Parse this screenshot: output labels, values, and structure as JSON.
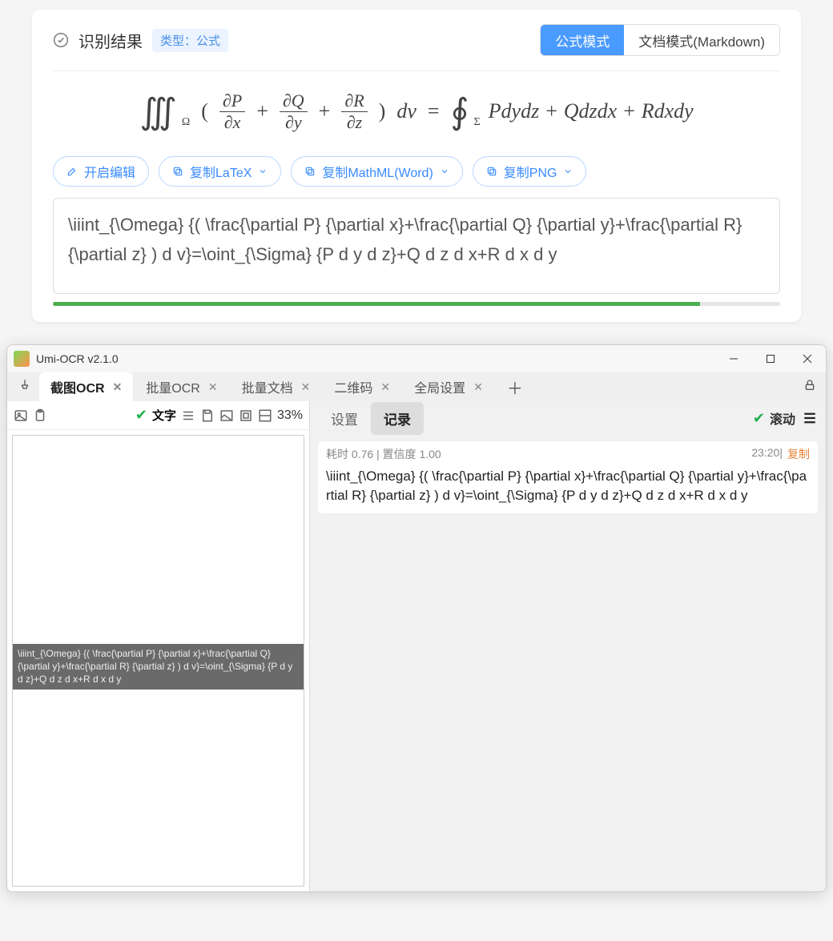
{
  "top_card": {
    "title": "识别结果",
    "chip_prefix": "类型：",
    "chip_value": "公式",
    "modes": {
      "formula": "公式模式",
      "markdown": "文档模式(Markdown)"
    },
    "actions": {
      "edit": "开启编辑",
      "copy_latex": "复制LaTeX",
      "copy_mathml": "复制MathML(Word)",
      "copy_png": "复制PNG"
    },
    "latex_text": "\\iiint_{\\Omega} {( \\frac{\\partial P} {\\partial x}+\\frac{\\partial Q} {\\partial y}+\\frac{\\partial R} {\\partial z} ) d v}=\\oint_{\\Sigma} {P d y d z}+Q d z d x+R d x d y",
    "progress_pct": 89,
    "formula_parts": {
      "int_sub": "Ω",
      "f1n": "∂P",
      "f1d": "∂x",
      "f2n": "∂Q",
      "f2d": "∂y",
      "f3n": "∂R",
      "f3d": "∂z",
      "dv": "dv",
      "oint_sub": "Σ",
      "rhs": "Pdydz + Qdzdx + Rdxdy"
    }
  },
  "umi": {
    "title": "Umi-OCR v2.1.0",
    "tabs": {
      "screenshot": "截图OCR",
      "batch_ocr": "批量OCR",
      "batch_doc": "批量文档",
      "qrcode": "二维码",
      "settings": "全局设置"
    },
    "left_tool": {
      "text_label": "文字",
      "zoom": "33%"
    },
    "overlay_text": "\\iiint_{\\Omega} {( \\frac{\\partial P} {\\partial x}+\\frac{\\partial Q} {\\partial y}+\\frac{\\partial R} {\\partial z} ) d v}=\\oint_{\\Sigma} {P d y d z}+Q d z d x+R d x d y",
    "right_tabs": {
      "settings": "设置",
      "log": "记录"
    },
    "scroll_label": "滚动",
    "result": {
      "meta_left": "耗时 0.76 | 置信度 1.00",
      "meta_time": "23:20",
      "meta_copy": "复制",
      "text": "\\iiint_{\\Omega} {( \\frac{\\partial P} {\\partial x}+\\frac{\\partial Q} {\\partial y}+\\frac{\\partial R} {\\partial z} ) d v}=\\oint_{\\Sigma} {P d y d z}+Q d z d x+R d x d y"
    }
  }
}
